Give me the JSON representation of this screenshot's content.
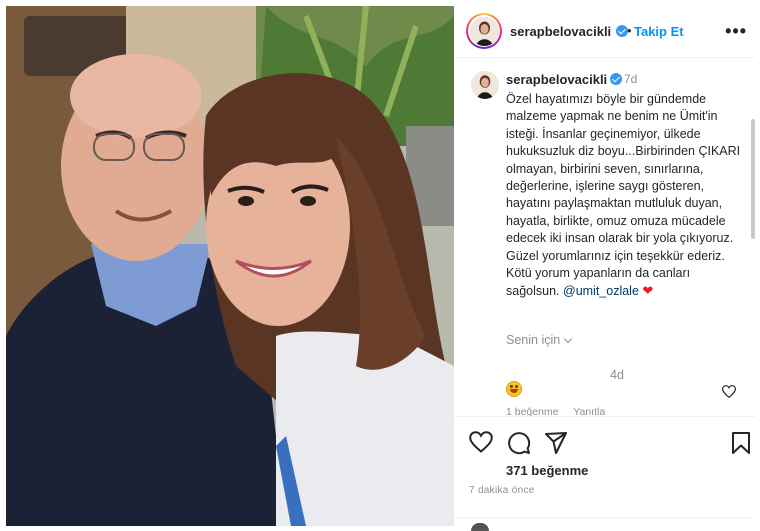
{
  "post": {
    "username": "serapbelovacikli",
    "follow_separator": "•",
    "follow_label": "Takip Et",
    "more_label": "•••",
    "verified": true
  },
  "caption": {
    "username": "serapbelovacikli",
    "time": "7d",
    "text": "Özel hayatımızı böyle bir gündemde malzeme yapmak ne benim ne Ümit'in isteği. İnsanlar geçinemiyor, ülkede hukuksuzluk diz boyu...Birbirinden ÇIKARI olmayan, birbirini seven, sınırlarına, değerlerine, işlerine saygı gösteren, hayatını paylaşmaktan mutluluk duyan, hayatla, birlikte, omuz omuza mücadele edecek iki insan olarak bir yola çıkıyoruz. Güzel yorumlarınız için teşekkür ederiz. Kötü yorum yapanların da canları sağolsun.",
    "mention": "@umit_ozlale",
    "emoji": "❤"
  },
  "comments": {
    "filter_label": "Senin için",
    "time": "4d",
    "likes_text": "1 beğenme",
    "reply_label": "Yanıtla"
  },
  "actions": {
    "likes": "371 beğenme",
    "posted": "7 dakika önce"
  },
  "icons": {
    "like": "heart-icon",
    "comment": "comment-icon",
    "share": "share-icon",
    "save": "bookmark-icon",
    "verified": "verified-badge-icon",
    "comment_like": "heart-outline-icon",
    "chevron": "chevron-down-icon"
  },
  "colors": {
    "accent": "#0095f6",
    "verified": "#3897f0",
    "text": "#262626",
    "muted": "#8e8e8e",
    "mention": "#00376b",
    "heart": "#ed1c24"
  }
}
